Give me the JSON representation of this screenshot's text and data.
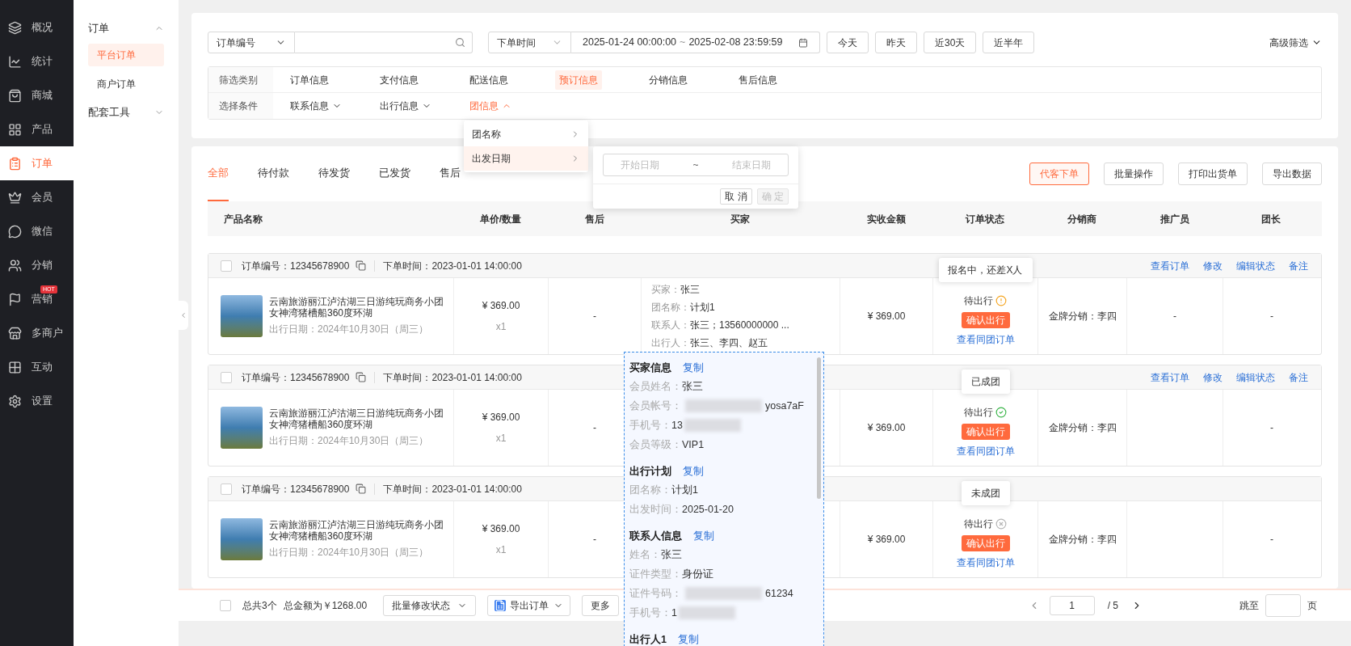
{
  "sidebar": {
    "items": [
      {
        "label": "概况",
        "selected": false
      },
      {
        "label": "统计",
        "selected": false
      },
      {
        "label": "商城",
        "selected": false
      },
      {
        "label": "产品",
        "selected": false
      },
      {
        "label": "订单",
        "selected": true
      },
      {
        "label": "会员",
        "selected": false
      },
      {
        "label": "微信",
        "selected": false
      },
      {
        "label": "分销",
        "selected": false
      },
      {
        "label": "营销",
        "selected": false,
        "badge": "HOT"
      },
      {
        "label": "多商户",
        "selected": false
      },
      {
        "label": "互动",
        "selected": false
      },
      {
        "label": "设置",
        "selected": false
      }
    ]
  },
  "subnav": {
    "groups": [
      {
        "label": "订单",
        "expanded": true,
        "children": [
          {
            "label": "平台订单",
            "selected": true
          },
          {
            "label": "商户订单",
            "selected": false
          }
        ]
      },
      {
        "label": "配套工具",
        "expanded": false
      }
    ]
  },
  "search": {
    "field_type": "订单编号",
    "time_type": "下单时间",
    "date_start": "2025-01-24 00:00:00",
    "date_separator": "~",
    "date_end": "2025-02-08 23:59:59",
    "quick_ranges": [
      "今天",
      "昨天",
      "近30天",
      "近半年"
    ],
    "advanced": "高级筛选"
  },
  "filter_categories": {
    "label": "筛选类别",
    "options": [
      {
        "label": "订单信息",
        "selected": false
      },
      {
        "label": "支付信息",
        "selected": false
      },
      {
        "label": "配送信息",
        "selected": false
      },
      {
        "label": "预订信息",
        "selected": true
      },
      {
        "label": "分销信息",
        "selected": false
      },
      {
        "label": "售后信息",
        "selected": false
      }
    ]
  },
  "filter_conditions": {
    "label": "选择条件",
    "options": [
      {
        "label": "联系信息",
        "expanded": false
      },
      {
        "label": "出行信息",
        "expanded": false
      },
      {
        "label": "团信息",
        "expanded": true
      }
    ]
  },
  "condition_menu": {
    "items": [
      {
        "label": "团名称",
        "selected": false
      },
      {
        "label": "出发日期",
        "selected": true
      }
    ]
  },
  "date_picker": {
    "start_placeholder": "开始日期",
    "separator": "~",
    "end_placeholder": "结束日期",
    "cancel": "取 消",
    "confirm": "确 定",
    "confirm_disabled": true
  },
  "tabs": [
    {
      "label": "全部",
      "selected": true
    },
    {
      "label": "待付款",
      "selected": false
    },
    {
      "label": "待发货",
      "selected": false
    },
    {
      "label": "已发货",
      "selected": false
    },
    {
      "label": "售后",
      "selected": false
    }
  ],
  "actions": [
    {
      "label": "代客下单",
      "kind": "primary"
    },
    {
      "label": "批量操作",
      "kind": "default"
    },
    {
      "label": "打印出货单",
      "kind": "default"
    },
    {
      "label": "导出数据",
      "kind": "default"
    }
  ],
  "table": {
    "columns": [
      "产品名称",
      "单价/数量",
      "售后",
      "买家",
      "实收金额",
      "订单状态",
      "分销商",
      "推广员",
      "团长"
    ],
    "orders": [
      {
        "checked": false,
        "order_no_label": "订单编号：",
        "order_no": "12345678900",
        "time_label": "下单时间：",
        "time": "2023-01-01 14:00:00",
        "links": [
          "查看订单",
          "修改",
          "编辑状态",
          "备注"
        ],
        "title": "云南旅游丽江泸沽湖三日游纯玩商务小团女神湾猪槽船360度环湖",
        "travel_date": "出行日期：2024年10月30日（周三）",
        "price": "¥ 369.00",
        "quantity": "x1",
        "after_sale": "-",
        "buyer": [
          {
            "label": "买家：",
            "value": "张三"
          },
          {
            "label": "团名称：",
            "value": "计划1"
          },
          {
            "label": "联系人：",
            "value": "张三；13560000000 ..."
          },
          {
            "label": "出行人：",
            "value": "张三、李四、赵五"
          }
        ],
        "amount": "¥ 369.00",
        "status": "待出行",
        "status_icon": {
          "kind": "warning"
        },
        "tooltip": "报名中，还差X人",
        "confirm": "确认出行",
        "group_link": "查看同团订单",
        "distributor": "金牌分销：李四",
        "promoter": "-",
        "leader": "-"
      },
      {
        "checked": false,
        "order_no_label": "订单编号：",
        "order_no": "12345678900",
        "time_label": "下单时间：",
        "time": "2023-01-01 14:00:00",
        "links": [
          "查看订单",
          "修改",
          "编辑状态",
          "备注"
        ],
        "title": "云南旅游丽江泸沽湖三日游纯玩商务小团女神湾猪槽船360度环湖",
        "travel_date": "出行日期：2024年10月30日（周三）",
        "price": "¥ 369.00",
        "quantity": "x1",
        "after_sale": "-",
        "amount": "¥ 369.00",
        "status": "待出行",
        "status_icon": {
          "kind": "success"
        },
        "tooltip": "已成团",
        "confirm": "确认出行",
        "group_link": "查看同团订单",
        "distributor": "金牌分销：李四",
        "leader": "-"
      },
      {
        "checked": false,
        "order_no_label": "订单编号：",
        "order_no": "12345678900",
        "time_label": "下单时间：",
        "time": "2023-01-01 14:00:00",
        "title": "云南旅游丽江泸沽湖三日游纯玩商务小团女神湾猪槽船360度环湖",
        "travel_date": "出行日期：2024年10月30日（周三）",
        "price": "¥ 369.00",
        "quantity": "x1",
        "after_sale": "-",
        "amount": "¥ 369.00",
        "status": "待出行",
        "status_icon": {
          "kind": "failed"
        },
        "tooltip": "未成团",
        "confirm": "确认出行",
        "group_link": "查看同团订单",
        "distributor": "金牌分销：李四",
        "leader": "-"
      }
    ]
  },
  "buyer_popup": {
    "sections": [
      {
        "title": "买家信息",
        "copy": "复制",
        "rows": [
          {
            "label": "会员姓名：",
            "value": "张三"
          },
          {
            "label": "会员帐号：",
            "value": "yosa7aF",
            "blur_before": true
          },
          {
            "label": "手机号：",
            "value": "13",
            "blur_after": true
          },
          {
            "label": "会员等级：",
            "value": "VIP1"
          }
        ]
      },
      {
        "title": "出行计划",
        "copy": "复制",
        "rows": [
          {
            "label": "团名称：",
            "value": "计划1"
          },
          {
            "label": "出发时间：",
            "value": "2025-01-20"
          }
        ]
      },
      {
        "title": "联系人信息",
        "copy": "复制",
        "rows": [
          {
            "label": "姓名：",
            "value": "张三"
          },
          {
            "label": "证件类型：",
            "value": "身份证"
          },
          {
            "label": "证件号码：",
            "value": "61234",
            "blur_before": true
          },
          {
            "label": "手机号：",
            "value": "1",
            "blur_after": true
          }
        ]
      },
      {
        "title": "出行人1",
        "copy": "复制"
      }
    ]
  },
  "footer": {
    "checked": false,
    "total_count": "总共3个",
    "total_amount": "总金额为￥1268.00",
    "batch_status": "批量修改状态",
    "export": "导出订单",
    "more": "更多",
    "page": "1",
    "page_total": "/ 5",
    "jump_label": "跳至",
    "page_unit": "页"
  }
}
